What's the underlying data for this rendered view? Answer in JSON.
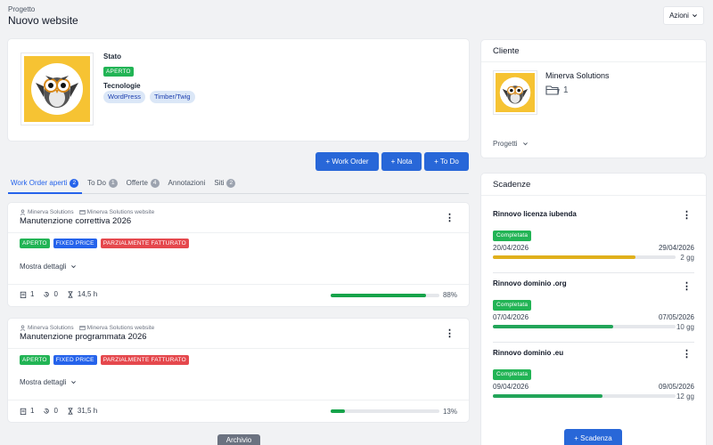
{
  "header": {
    "breadcrumb": "Progetto",
    "title": "Nuovo website",
    "actions_label": "Azioni"
  },
  "project": {
    "stato_label": "Stato",
    "stato_value": "APERTO",
    "tech_label": "Tecnologie",
    "technologies": [
      "WordPress",
      "Timber/Twig"
    ]
  },
  "buttons": {
    "work_order": "+ Work Order",
    "nota": "+ Nota",
    "todo": "+ To Do"
  },
  "tabs": [
    {
      "label": "Work Order aperti",
      "count": "2"
    },
    {
      "label": "To Do",
      "count": "1"
    },
    {
      "label": "Offerte",
      "count": "4"
    },
    {
      "label": "Annotazioni",
      "count": ""
    },
    {
      "label": "Siti",
      "count": "2"
    }
  ],
  "work_orders": [
    {
      "client": "Minerva Solutions",
      "site": "Minerva Solutions website",
      "title": "Manutenzione correttiva 2026",
      "badges": [
        "APERTO",
        "FIXED PRICE",
        "PARZIALMENTE FATTURATO"
      ],
      "details_label": "Mostra dettagli",
      "tasks": "1",
      "history": "0",
      "hours": "14,5 h",
      "progress": 88,
      "progress_label": "88%"
    },
    {
      "client": "Minerva Solutions",
      "site": "Minerva Solutions website",
      "title": "Manutenzione programmata 2026",
      "badges": [
        "APERTO",
        "FIXED PRICE",
        "PARZIALMENTE FATTURATO"
      ],
      "details_label": "Mostra dettagli",
      "tasks": "1",
      "history": "0",
      "hours": "31,5 h",
      "progress": 13,
      "progress_label": "13%"
    }
  ],
  "archive_label": "Archivio",
  "client": {
    "section_title": "Cliente",
    "name": "Minerva Solutions",
    "folder_count": "1",
    "projects_label": "Progetti"
  },
  "deadlines": {
    "section_title": "Scadenze",
    "items": [
      {
        "title": "Rinnovo licenza iubenda",
        "status": "Completata",
        "start": "20/04/2026",
        "end": "29/04/2026",
        "progress": 78,
        "color": "#e0b01c",
        "days": "2 gg"
      },
      {
        "title": "Rinnovo dominio .org",
        "status": "Completata",
        "start": "07/04/2026",
        "end": "07/05/2026",
        "progress": 66,
        "color": "#22a559",
        "days": "10 gg"
      },
      {
        "title": "Rinnovo dominio .eu",
        "status": "Completata",
        "start": "09/04/2026",
        "end": "09/05/2026",
        "progress": 60,
        "color": "#22a559",
        "days": "12 gg"
      }
    ],
    "add_label": "+ Scadenza"
  },
  "colors": {
    "primary": "#2867d8",
    "green": "#22b455",
    "red": "#e5484d",
    "amber": "#e0b01c"
  }
}
